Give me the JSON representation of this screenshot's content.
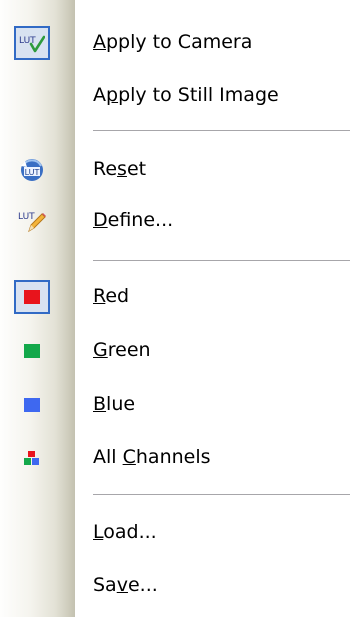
{
  "menu": {
    "items": [
      {
        "pre": "",
        "u": "A",
        "post": "pply to Camera",
        "icon": "lut-check-icon",
        "checked": true
      },
      {
        "pre": "A",
        "u": "p",
        "post": "ply to Still Image",
        "icon": "",
        "checked": false
      },
      {
        "pre": "Re",
        "u": "s",
        "post": "et",
        "icon": "lut-reset-icon",
        "checked": false
      },
      {
        "pre": "",
        "u": "D",
        "post": "efine...",
        "icon": "lut-pencil-icon",
        "checked": false
      },
      {
        "pre": "",
        "u": "R",
        "post": "ed",
        "icon": "red-square-icon",
        "checked": true
      },
      {
        "pre": "",
        "u": "G",
        "post": "reen",
        "icon": "green-square-icon",
        "checked": false
      },
      {
        "pre": "",
        "u": "B",
        "post": "lue",
        "icon": "blue-square-icon",
        "checked": false
      },
      {
        "pre": "All ",
        "u": "C",
        "post": "hannels",
        "icon": "rgb-channels-icon",
        "checked": false
      },
      {
        "pre": "",
        "u": "L",
        "post": "oad...",
        "icon": "",
        "checked": false
      },
      {
        "pre": "Sa",
        "u": "v",
        "post": "e...",
        "icon": "",
        "checked": false
      }
    ],
    "icon_text": "LUT",
    "colors": {
      "red": "#e8141c",
      "green": "#13a84a",
      "blue": "#3e68f0",
      "check_green": "#2e9b3c",
      "highlight_border": "#316ac5",
      "highlight_fill": "#d8e2f1",
      "separator": "#a7a6aa"
    }
  }
}
